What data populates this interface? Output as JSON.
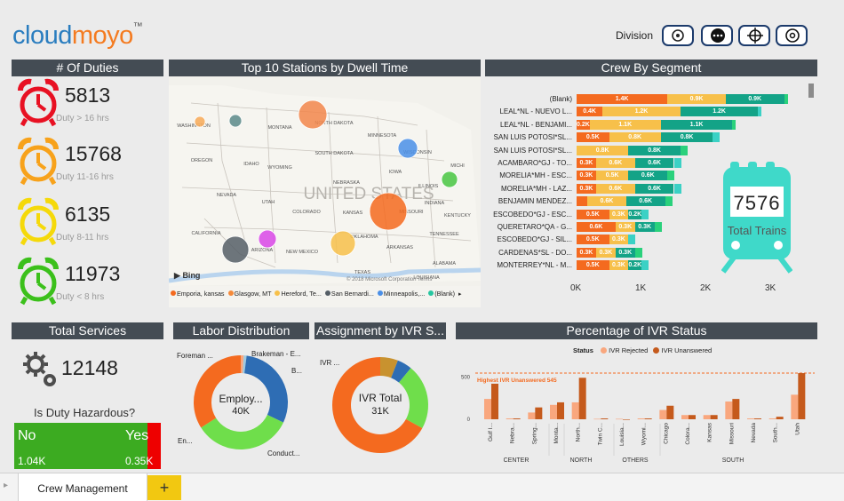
{
  "logo": {
    "text_part1": "cloud",
    "text_part2": "moyo",
    "tm": "™"
  },
  "division": {
    "label": "Division"
  },
  "duties": {
    "title": "# Of Duties",
    "items": [
      {
        "value": "5813",
        "label": "Duty > 16 hrs",
        "color": "#e81123"
      },
      {
        "value": "15768",
        "label": "Duty 11-16 hrs",
        "color": "#f7a21b"
      },
      {
        "value": "6135",
        "label": "Duty 8-11 hrs",
        "color": "#f5d90a"
      },
      {
        "value": "11973",
        "label": "Duty < 8 hrs",
        "color": "#3bc01b"
      }
    ]
  },
  "map": {
    "title": "Top 10 Stations by Dwell Time",
    "country": "UNITED STATES",
    "states": [
      "WASHINGTON",
      "MONTANA",
      "NORTH DAKOTA",
      "MINNESOTA",
      "OREGON",
      "IDAHO",
      "SOUTH DAKOTA",
      "WISCONSIN",
      "WYOMING",
      "MICHI",
      "NEBRASKA",
      "IOWA",
      "NEVADA",
      "UTAH",
      "COLORADO",
      "KANSAS",
      "ILLINOIS",
      "INDIANA",
      "CALIFORNIA",
      "MISSOURI",
      "KENTUCKY",
      "OKLAHOMA",
      "TENNESSEE",
      "ARIZONA",
      "NEW MEXICO",
      "ARKANSAS",
      "TEXAS",
      "ALABAMA",
      "LOUISIANA"
    ],
    "bing": "Bing",
    "copyright": "© 2018 Microsoft Corporation  Terms",
    "legend": [
      {
        "label": "Emporia, kansas",
        "color": "#f46a1f"
      },
      {
        "label": "Glasgow, MT",
        "color": "#f58a3a"
      },
      {
        "label": "Hereford, Te...",
        "color": "#f7c04a"
      },
      {
        "label": "San Bernardi...",
        "color": "#555e66"
      },
      {
        "label": "Minneapolis,...",
        "color": "#4a8fe7"
      },
      {
        "label": "(Blank)",
        "color": "#26c6a0"
      }
    ],
    "legend_more": "▸"
  },
  "crew": {
    "title": "Crew By Segment",
    "rows": [
      {
        "label": "(Blank)",
        "vals": [
          "1.4K",
          "0.9K",
          "0.9K"
        ]
      },
      {
        "label": "LEAL*NL - NUEVO L...",
        "vals": [
          "0.4K",
          "1.2K",
          "1.2K"
        ]
      },
      {
        "label": "LEAL*NL - BENJAMI...",
        "vals": [
          "0.2K",
          "1.1K",
          "1.1K"
        ]
      },
      {
        "label": "SAN LUIS POTOSI*SL...",
        "vals": [
          "0.5K",
          "0.8K",
          "0.8K"
        ]
      },
      {
        "label": "SAN LUIS POTOSI*SL...",
        "vals": [
          "",
          "0.8K",
          "0.8K"
        ]
      },
      {
        "label": "ACAMBARO*GJ - TO...",
        "vals": [
          "0.3K",
          "0.6K",
          "0.6K"
        ]
      },
      {
        "label": "MORELIA*MH - ESC...",
        "vals": [
          "0.3K",
          "0.5K",
          "0.6K"
        ]
      },
      {
        "label": "MORELIA*MH - LAZ...",
        "vals": [
          "0.3K",
          "0.6K",
          "0.6K"
        ]
      },
      {
        "label": "BENJAMIN MENDEZ...",
        "vals": [
          "",
          "0.6K",
          "0.6K"
        ]
      },
      {
        "label": "ESCOBEDO*GJ - ESC...",
        "vals": [
          "0.5K",
          "0.3K",
          "0.2K"
        ]
      },
      {
        "label": "QUERETARO*QA - G...",
        "vals": [
          "0.6K",
          "0.3K",
          "0.3K"
        ]
      },
      {
        "label": "ESCOBEDO*GJ - SIL...",
        "vals": [
          "0.5K",
          "0.3K",
          ""
        ]
      },
      {
        "label": "CARDENAS*SL - DO...",
        "vals": [
          "0.3K",
          "0.3K",
          "0.3K"
        ]
      },
      {
        "label": "MONTERREY*NL - M...",
        "vals": [
          "0.5K",
          "0.3K",
          "0.2K"
        ]
      }
    ],
    "axis": [
      "0K",
      "1K",
      "2K",
      "3K"
    ],
    "colors": [
      "#f46a1f",
      "#f7c04a",
      "#13a387",
      "#2ad17c",
      "#3bd1c5"
    ]
  },
  "trains": {
    "value": "7576",
    "label": "Total Trains",
    "color": "#3fd9c9"
  },
  "services": {
    "title": "Total Services",
    "value": "12148",
    "question": "Is Duty Hazardous?",
    "no_label": "No",
    "no_value": "1.04K",
    "yes_label": "Yes",
    "yes_value": "0.35K"
  },
  "labor": {
    "title": "Labor Distribution",
    "center_label": "Employ...",
    "center_value": "40K",
    "labels": [
      "Foreman ...",
      "Brakeman - E...",
      "B...",
      "En...",
      "Conduct..."
    ]
  },
  "ivr_assign": {
    "title": "Assignment by IVR S...",
    "center_label": "IVR Total",
    "center_value": "31K",
    "labels": [
      "IVR ..."
    ]
  },
  "ivr_status": {
    "title": "Percentage of IVR Status",
    "legend_title": "Status",
    "series": [
      {
        "name": "IVR Rejected",
        "color": "#f9a77e"
      },
      {
        "name": "IVR Unanswered",
        "color": "#c55a1c"
      }
    ],
    "highest": "Highest IVR Unanswered 545",
    "y_ticks": [
      "500",
      "0"
    ],
    "categories": [
      "Gulf I...",
      "Nebra...",
      "Spring...",
      "Monta...",
      "North...",
      "Twin C...",
      "Louisia...",
      "Wyomi...",
      "Chicago",
      "Colora...",
      "Kansas",
      "Missouri",
      "Nevada",
      "South...",
      "Utah"
    ],
    "rejected": [
      240,
      10,
      80,
      170,
      200,
      5,
      5,
      10,
      110,
      50,
      50,
      210,
      10,
      10,
      290
    ],
    "unanswered": [
      420,
      10,
      140,
      200,
      490,
      10,
      0,
      10,
      160,
      50,
      50,
      240,
      10,
      30,
      545
    ],
    "groups": [
      "CENTER",
      "NORTH",
      "OTHERS",
      "SOUTH"
    ],
    "ymax": 600
  },
  "tabs": {
    "active": "Crew Management",
    "add": "+"
  }
}
